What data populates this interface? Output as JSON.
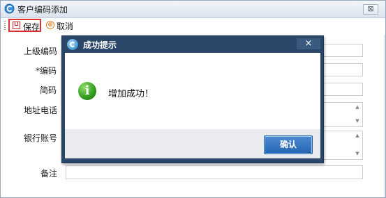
{
  "window": {
    "title": "客户编码添加",
    "close_label": "⊠",
    "icon": "app-logo-icon"
  },
  "toolbar": {
    "save_label": "保存",
    "cancel_label": "取消",
    "cancel_icon": "⊗"
  },
  "form": {
    "fields": [
      {
        "label": "上级编码",
        "value": ""
      },
      {
        "label": "*编码",
        "value": ""
      },
      {
        "label": "简码",
        "value": ""
      },
      {
        "label": "地址电话",
        "value": ""
      },
      {
        "label": "银行账号",
        "value": ""
      },
      {
        "label": "备注",
        "value": ""
      }
    ]
  },
  "dialog": {
    "title": "成功提示",
    "close_label": "×",
    "message": "增加成功！",
    "ok_label": "确认",
    "icon_letter": "i",
    "accent_color": "#2a4668",
    "ok_color": "#2466b4",
    "info_color": "#2f9a1c"
  }
}
